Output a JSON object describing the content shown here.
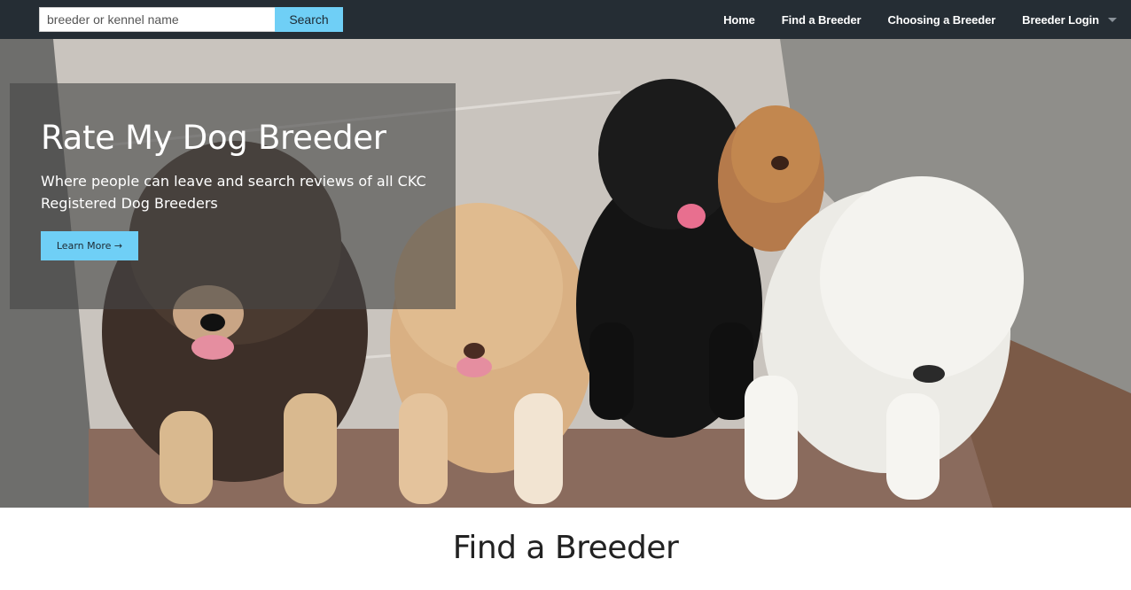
{
  "search": {
    "placeholder": "breeder or kennel name",
    "button_label": "Search"
  },
  "nav": {
    "home": "Home",
    "find_breeder": "Find a Breeder",
    "choosing_breeder": "Choosing a Breeder",
    "breeder_login": "Breeder Login",
    "dropdown_icon": "caret-down-icon"
  },
  "hero": {
    "title": "Rate My Dog Breeder",
    "subtitle": "Where people can leave and search reviews of all CKC Registered Dog Breeders",
    "button_label": "Learn More →",
    "image": "puppies-photo"
  },
  "section": {
    "title": "Find a Breeder"
  },
  "colors": {
    "nav_bg": "#252d34",
    "accent": "#6fcff6",
    "overlay": "rgba(70,70,70,0.62)"
  }
}
